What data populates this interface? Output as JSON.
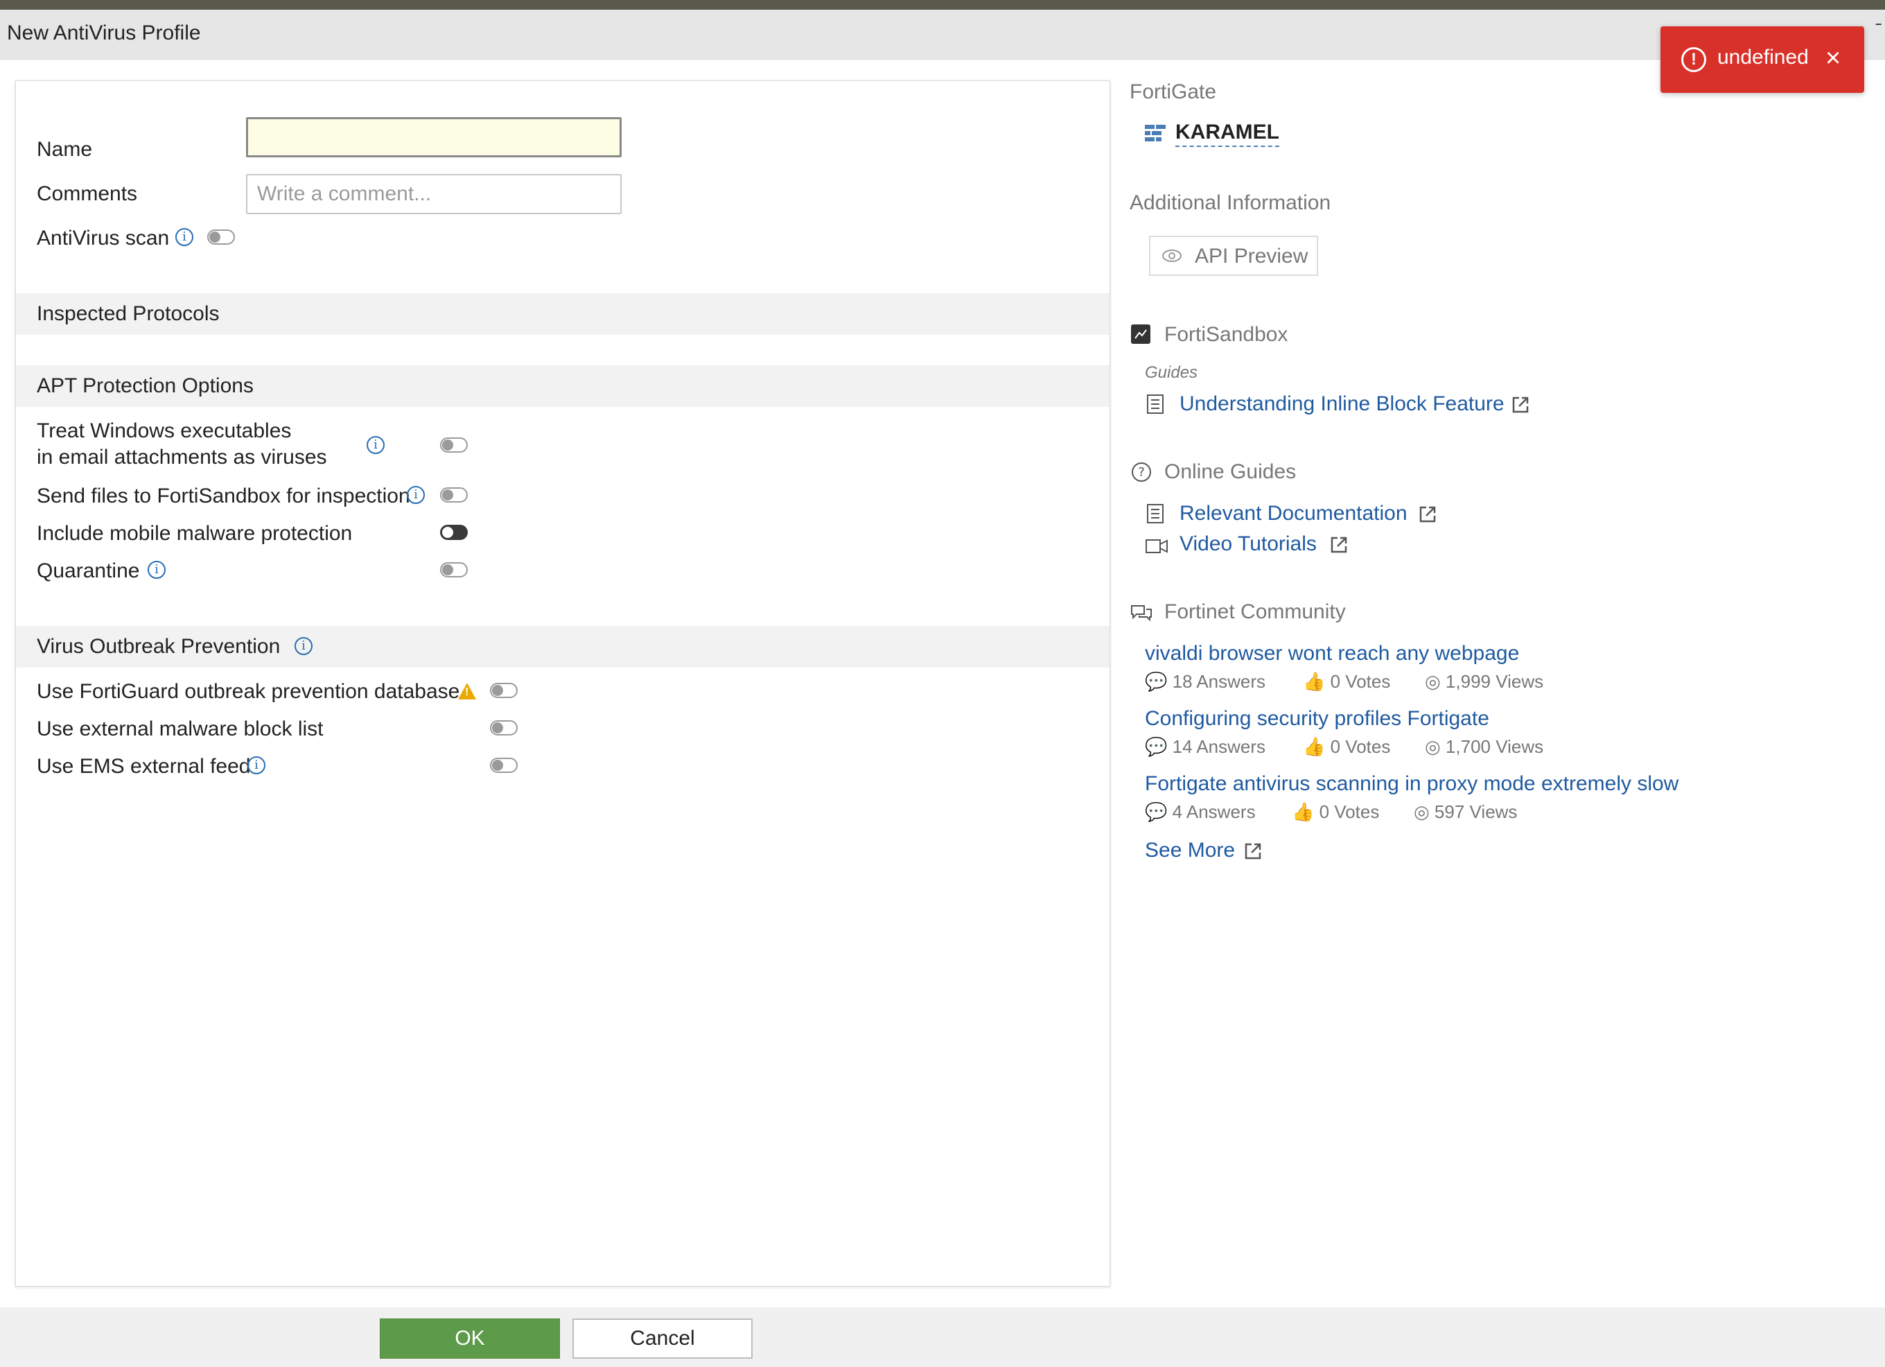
{
  "window": {
    "title": "New AntiVirus Profile"
  },
  "toast": {
    "message": "undefined",
    "icon": "error-icon",
    "color": "#d8312a"
  },
  "form": {
    "name_label": "Name",
    "name_value": "",
    "comments_label": "Comments",
    "comments_placeholder": "Write a comment...",
    "antivirus_scan_label": "AntiVirus scan",
    "antivirus_scan_enabled": false
  },
  "sections": {
    "inspected_protocols": "Inspected Protocols",
    "apt_protection": "APT Protection Options",
    "virus_outbreak": "Virus Outbreak Prevention"
  },
  "apt_options": [
    {
      "label_line1": "Treat Windows executables",
      "label_line2": "in email attachments as viruses",
      "enabled": false
    },
    {
      "label": "Send files to FortiSandbox for inspection",
      "enabled": false
    },
    {
      "label": "Include mobile malware protection",
      "enabled": true
    },
    {
      "label": "Quarantine",
      "enabled": false
    }
  ],
  "outbreak_options": [
    {
      "label": "Use FortiGuard outbreak prevention database",
      "enabled": false
    },
    {
      "label": "Use external malware block list",
      "enabled": false
    },
    {
      "label": "Use EMS external feed",
      "enabled": false
    }
  ],
  "sidebar": {
    "fortigate_heading": "FortiGate",
    "device_name": "KARAMEL",
    "additional_info_heading": "Additional Information",
    "api_preview_label": "API Preview",
    "fortisandbox_heading": "FortiSandbox",
    "guides_label": "Guides",
    "inline_block_link": "Understanding Inline Block Feature",
    "online_guides_heading": "Online Guides",
    "relevant_docs_link": "Relevant Documentation",
    "video_tutorials_link": "Video Tutorials",
    "community_heading": "Fortinet Community",
    "community_posts": [
      {
        "title": "vivaldi browser wont reach any webpage",
        "answers": "18",
        "votes": "0",
        "views": "1,999"
      },
      {
        "title": "Configuring security profiles Fortigate",
        "answers": "14",
        "votes": "0",
        "views": "1,700"
      },
      {
        "title": "Fortigate antivirus scanning in proxy mode extremely slow",
        "answers": "4",
        "votes": "0",
        "views": "597"
      }
    ],
    "answers_word": "Answers",
    "votes_word": "Votes",
    "views_word": "Views",
    "see_more_link": "See More"
  },
  "footer": {
    "ok_label": "OK",
    "cancel_label": "Cancel"
  }
}
